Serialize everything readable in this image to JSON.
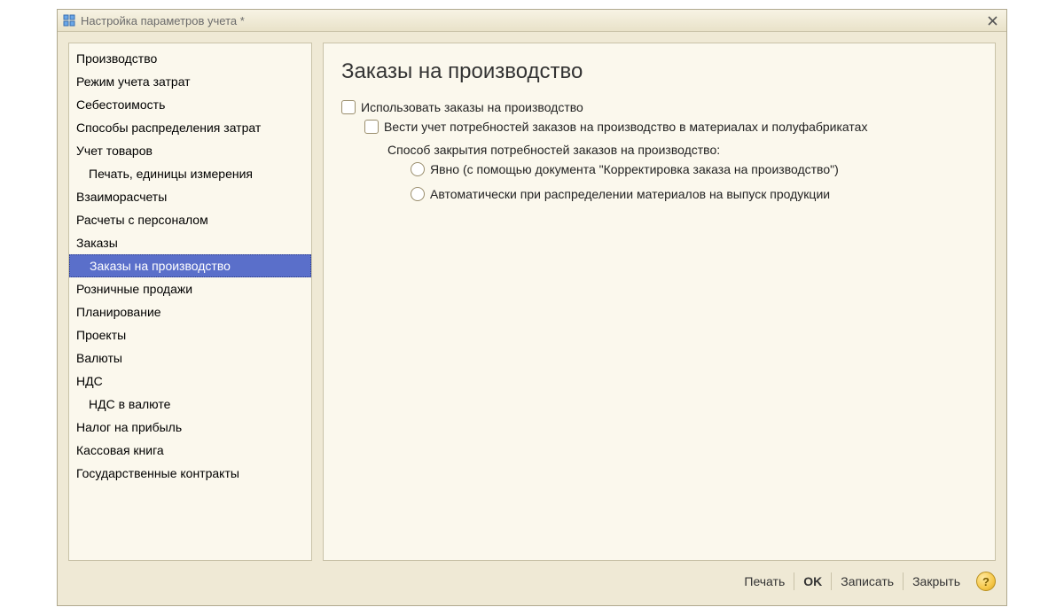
{
  "window": {
    "title": "Настройка параметров учета *"
  },
  "sidebar": {
    "items": [
      {
        "label": "Производство",
        "indent": 0,
        "selected": false
      },
      {
        "label": "Режим учета затрат",
        "indent": 0,
        "selected": false
      },
      {
        "label": "Себестоимость",
        "indent": 0,
        "selected": false
      },
      {
        "label": "Способы распределения затрат",
        "indent": 0,
        "selected": false
      },
      {
        "label": "Учет товаров",
        "indent": 0,
        "selected": false
      },
      {
        "label": "Печать, единицы измерения",
        "indent": 1,
        "selected": false
      },
      {
        "label": "Взаиморасчеты",
        "indent": 0,
        "selected": false
      },
      {
        "label": "Расчеты с персоналом",
        "indent": 0,
        "selected": false
      },
      {
        "label": "Заказы",
        "indent": 0,
        "selected": false
      },
      {
        "label": "Заказы на производство",
        "indent": 1,
        "selected": true
      },
      {
        "label": "Розничные продажи",
        "indent": 0,
        "selected": false
      },
      {
        "label": "Планирование",
        "indent": 0,
        "selected": false
      },
      {
        "label": "Проекты",
        "indent": 0,
        "selected": false
      },
      {
        "label": "Валюты",
        "indent": 0,
        "selected": false
      },
      {
        "label": "НДС",
        "indent": 0,
        "selected": false
      },
      {
        "label": "НДС в валюте",
        "indent": 1,
        "selected": false
      },
      {
        "label": "Налог на прибыль",
        "indent": 0,
        "selected": false
      },
      {
        "label": "Кассовая книга",
        "indent": 0,
        "selected": false
      },
      {
        "label": "Государственные контракты",
        "indent": 0,
        "selected": false
      }
    ]
  },
  "main": {
    "heading": "Заказы на производство",
    "check1_label": "Использовать заказы на производство",
    "check2_label": "Вести учет потребностей заказов на производство в материалах и полуфабрикатах",
    "group_label": "Способ закрытия потребностей заказов на производство:",
    "radio1_label": "Явно (с помощью документа \"Корректировка заказа на производство\")",
    "radio2_label": "Автоматически при распределении материалов на выпуск продукции"
  },
  "footer": {
    "print": "Печать",
    "ok": "OK",
    "save": "Записать",
    "close": "Закрыть",
    "help": "?"
  }
}
